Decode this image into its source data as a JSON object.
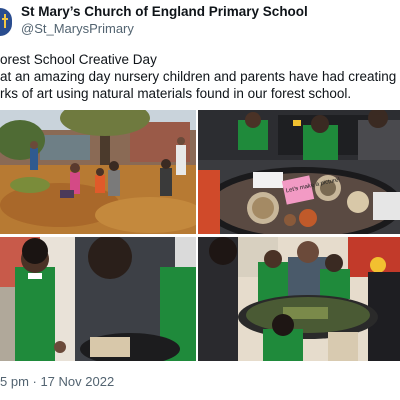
{
  "header": {
    "display_name": "St Mary’s Church of England Primary School",
    "handle": "@St_MarysPrimary"
  },
  "tweet": {
    "lines": [
      "orest School Creative Day",
      "at an amazing day nursery children and parents have had creating",
      "rks of art using natural materials found in our forest school."
    ],
    "timestamp": "5 pm · 17 Nov 2022"
  },
  "media": {
    "photos": [
      {
        "label": "forest-school-group-photo"
      },
      {
        "label": "leaf-art-table-photo"
      },
      {
        "label": "child-with-adult-photo"
      },
      {
        "label": "children-at-art-table-photo"
      }
    ],
    "sign_text": "Let's make a picture!"
  },
  "colors": {
    "brand_navy": "#2a4d8f",
    "text_primary": "#0f1419",
    "text_secondary": "#536471",
    "uniform_green": "#1f8a3b"
  }
}
